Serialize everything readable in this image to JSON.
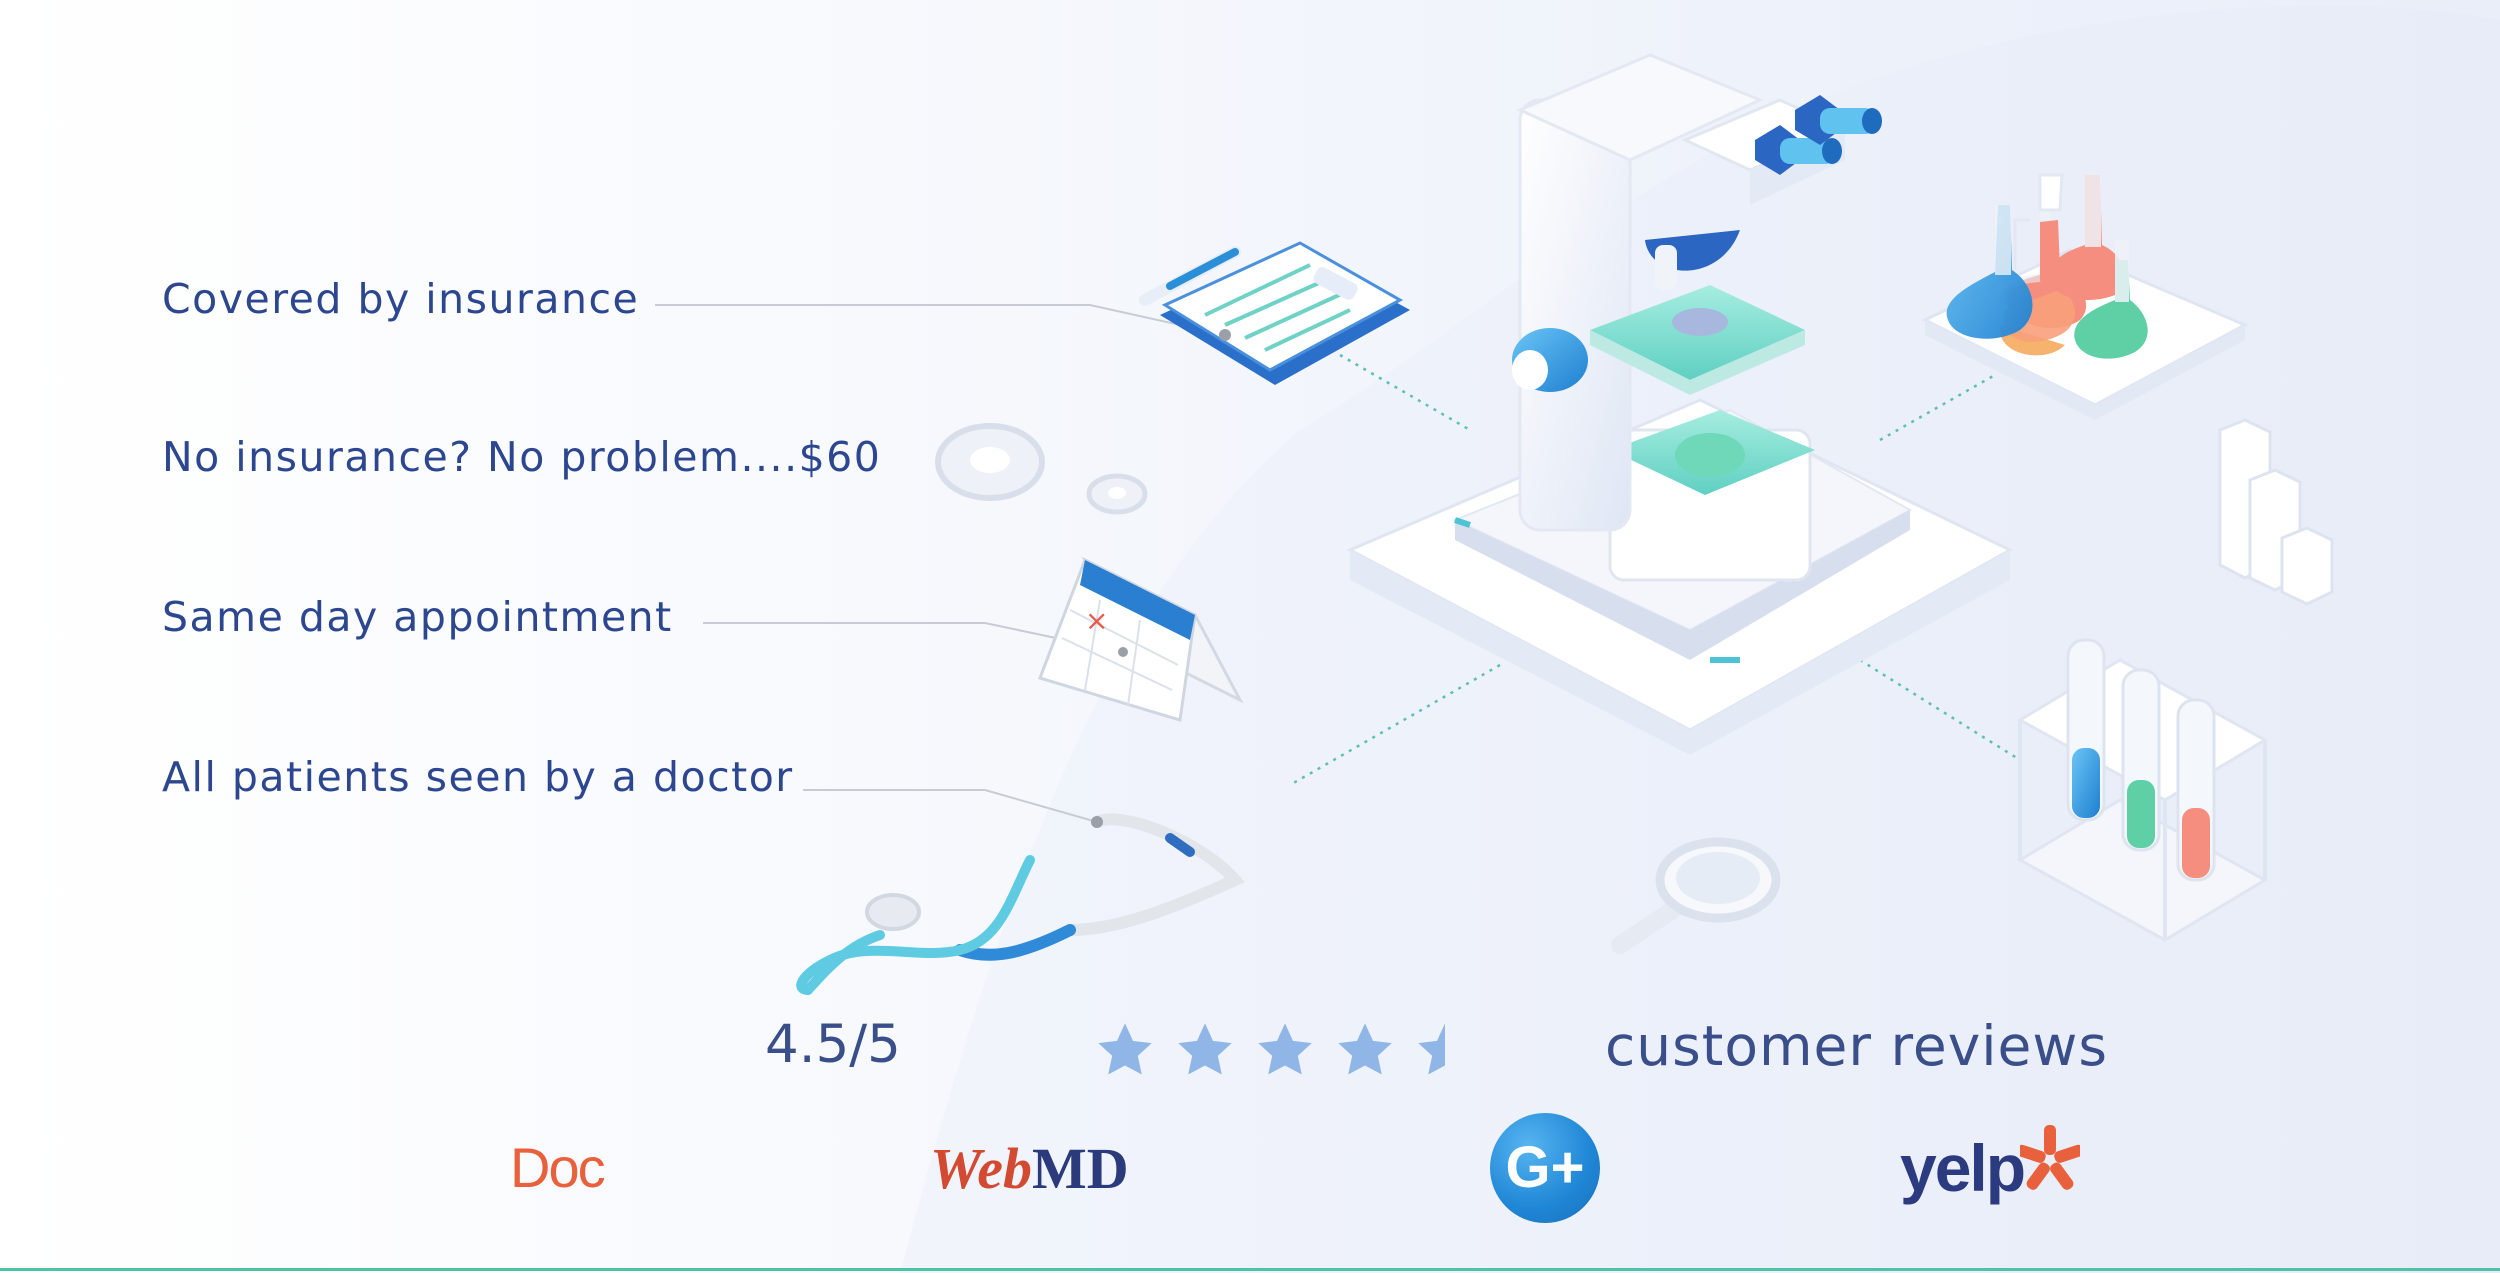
{
  "features": [
    {
      "label": "Covered by insurance"
    },
    {
      "label": "No insurance? No problem....$60"
    },
    {
      "label": "Same day appointment"
    },
    {
      "label": "All patients seen by a doctor"
    }
  ],
  "rating": {
    "score_text": "4.5/5",
    "score": 4.5,
    "max": 5,
    "reviews_label": "customer reviews",
    "star_color": "#8fb6e6"
  },
  "logos": {
    "doc": "Doc",
    "webmd_web": "Web",
    "webmd_md": "MD",
    "gplus": "G+",
    "yelp": "yelp"
  },
  "colors": {
    "text": "#2c4790",
    "accent_teal": "#4cc4a4",
    "accent_blue": "#2a8fd6",
    "doc_red": "#e8603c",
    "yelp_navy": "#2c3a80"
  },
  "icons": [
    "clipboard-icon",
    "pen-icon",
    "gear-icon",
    "calendar-icon",
    "stethoscope-icon",
    "microscope-icon",
    "flasks-icon",
    "bar-chart-icon",
    "test-tubes-icon",
    "magnifier-icon",
    "star-icon"
  ]
}
